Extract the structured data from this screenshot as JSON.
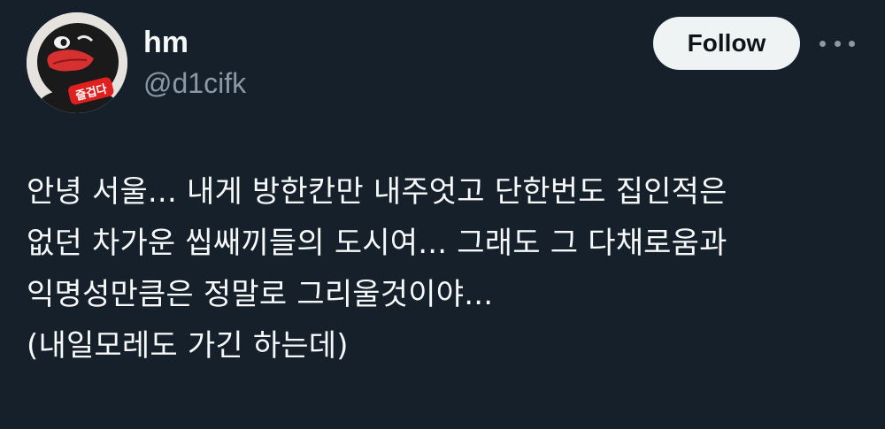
{
  "author": {
    "display_name": "hm",
    "handle": "@d1cifk",
    "avatar_label": "즐겁다"
  },
  "actions": {
    "follow_label": "Follow",
    "more_icon": "more-horizontal-icon"
  },
  "tweet": {
    "lines": [
      "안녕 서울... 내게 방한칸만 내주엇고 단한번도 집인적은",
      "없던 차가운 씹쌔끼들의 도시여... 그래도 그 다채로움과",
      "익명성만큼은 정말로 그리울것이야...",
      "(내일모레도 가긴 하는데)"
    ]
  },
  "colors": {
    "background": "#15202b",
    "text": "#f7f9f9",
    "secondary_text": "#8b98a5",
    "follow_button_bg": "#eff3f4",
    "avatar_badge": "#e0201e"
  }
}
